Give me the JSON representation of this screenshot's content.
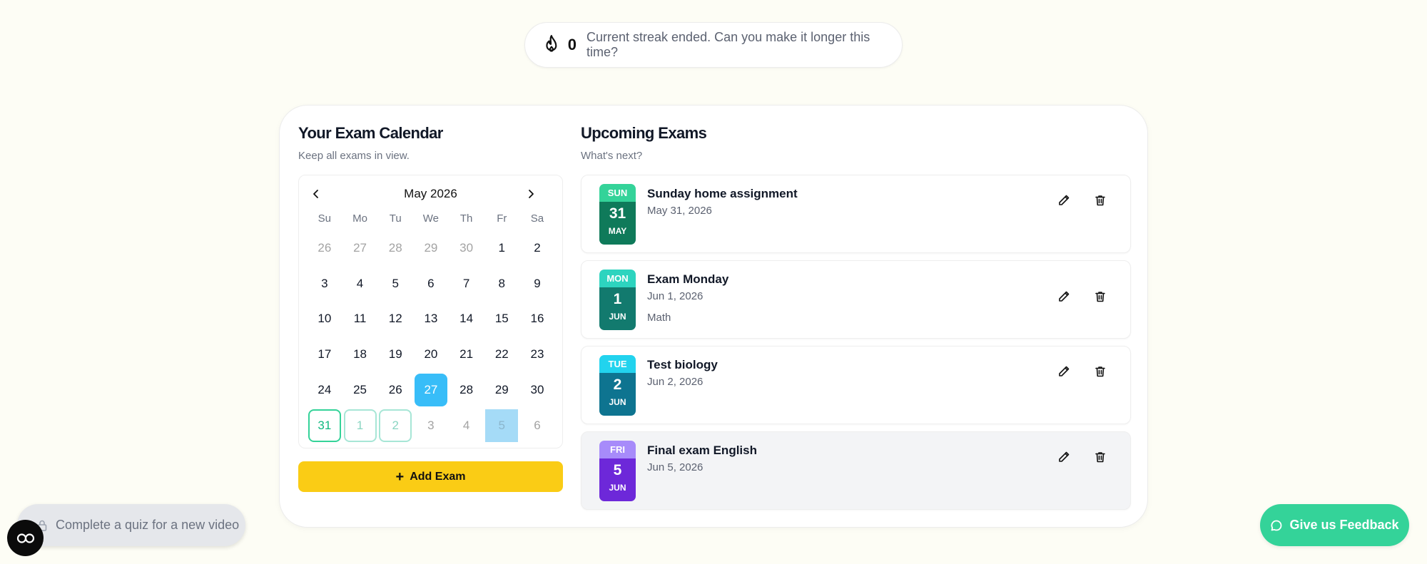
{
  "streak": {
    "count": "0",
    "message": "Current streak ended. Can you make it longer this time?",
    "icon": "flame-icon"
  },
  "calendar_section": {
    "title": "Your Exam Calendar",
    "subtitle": "Keep all exams in view.",
    "month_label": "May 2026",
    "weekdays": [
      "Su",
      "Mo",
      "Tu",
      "We",
      "Th",
      "Fr",
      "Sa"
    ],
    "days": [
      "26",
      "27",
      "28",
      "29",
      "30",
      "1",
      "2",
      "3",
      "4",
      "5",
      "6",
      "7",
      "8",
      "9",
      "10",
      "11",
      "12",
      "13",
      "14",
      "15",
      "16",
      "17",
      "18",
      "19",
      "20",
      "21",
      "22",
      "23",
      "24",
      "25",
      "26",
      "27",
      "28",
      "29",
      "30",
      "31",
      "1",
      "2",
      "3",
      "4",
      "5",
      "6"
    ],
    "today_color": "#38bdf8",
    "add_button_label": "Add Exam",
    "add_button_color": "#facc15"
  },
  "upcoming_section": {
    "title": "Upcoming Exams",
    "subtitle": "What's next?",
    "exams": [
      {
        "dow": "SUN",
        "day": "31",
        "month": "MAY",
        "title": "Sunday home assignment",
        "date": "May 31, 2026",
        "note": "",
        "top_color": "#34d399",
        "bottom_color": "#0f7a5a"
      },
      {
        "dow": "MON",
        "day": "1",
        "month": "JUN",
        "title": "Exam Monday",
        "date": "Jun 1, 2026",
        "note": "Math",
        "top_color": "#2dd4bf",
        "bottom_color": "#127a6e"
      },
      {
        "dow": "TUE",
        "day": "2",
        "month": "JUN",
        "title": "Test biology",
        "date": "Jun 2, 2026",
        "note": "",
        "top_color": "#22d3ee",
        "bottom_color": "#0e7490"
      },
      {
        "dow": "FRI",
        "day": "5",
        "month": "JUN",
        "title": "Final exam English",
        "date": "Jun 5, 2026",
        "note": "",
        "top_color": "#a78bfa",
        "bottom_color": "#6d28d9"
      }
    ]
  },
  "quiz_prompt": {
    "label": "Complete a quiz for a new video"
  },
  "feedback_button": {
    "label": "Give us Feedback",
    "color": "#34d399"
  }
}
